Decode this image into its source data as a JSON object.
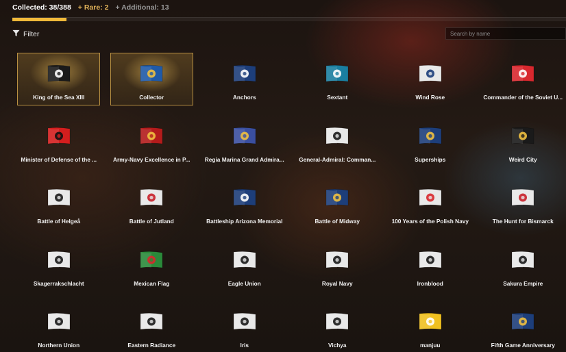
{
  "header": {
    "collected": "Collected: 38/388",
    "rare": "+ Rare: 2",
    "additional": "+ Additional: 13",
    "progress_fraction": 0.098
  },
  "filter": {
    "label": "Filter"
  },
  "search": {
    "placeholder": "Search by name"
  },
  "flags": [
    {
      "name": "King of the Sea XIII",
      "rare": true,
      "colors": [
        "#1a1a1a",
        "#ffffff"
      ],
      "icon": "skull-flag-icon"
    },
    {
      "name": "Collector",
      "rare": true,
      "colors": [
        "#1f5aa8",
        "#f0c040"
      ],
      "icon": "collector-flag-icon"
    },
    {
      "name": "Anchors",
      "rare": false,
      "colors": [
        "#1d3e7a",
        "#ffffff"
      ],
      "icon": "anchors-flag-icon"
    },
    {
      "name": "Sextant",
      "rare": false,
      "colors": [
        "#1a7ea0",
        "#ffffff"
      ],
      "icon": "sextant-flag-icon"
    },
    {
      "name": "Wind Rose",
      "rare": false,
      "colors": [
        "#e8e8e8",
        "#1d3e7a"
      ],
      "icon": "wind-rose-flag-icon"
    },
    {
      "name": "Commander of the Soviet U...",
      "rare": false,
      "colors": [
        "#d8282e",
        "#ffffff"
      ],
      "icon": "soviet-commander-flag-icon"
    },
    {
      "name": "Minister of Defense of the ...",
      "rare": false,
      "colors": [
        "#d41e1e",
        "#111111"
      ],
      "icon": "minister-defense-flag-icon"
    },
    {
      "name": "Army-Navy Excellence in P...",
      "rare": false,
      "colors": [
        "#b31b1b",
        "#f0c040"
      ],
      "icon": "army-navy-flag-icon"
    },
    {
      "name": "Regia Marina Grand Admira...",
      "rare": false,
      "colors": [
        "#3a4fa0",
        "#f0c040"
      ],
      "icon": "regia-marina-flag-icon"
    },
    {
      "name": "General-Admiral: Comman...",
      "rare": false,
      "colors": [
        "#e8e8e8",
        "#1a1a1a"
      ],
      "icon": "general-admiral-flag-icon"
    },
    {
      "name": "Superships",
      "rare": false,
      "colors": [
        "#1d3e7a",
        "#f0c040"
      ],
      "icon": "superships-flag-icon"
    },
    {
      "name": "Weird City",
      "rare": false,
      "colors": [
        "#1a1a1a",
        "#f0c040"
      ],
      "icon": "weird-city-flag-icon"
    },
    {
      "name": "Battle of Helgeå",
      "rare": false,
      "colors": [
        "#e8e8e8",
        "#1a1a1a"
      ],
      "icon": "helgea-flag-icon"
    },
    {
      "name": "Battle of Jutland",
      "rare": false,
      "colors": [
        "#e8e8e8",
        "#c8202a"
      ],
      "icon": "jutland-flag-icon"
    },
    {
      "name": "Battleship Arizona Memorial",
      "rare": false,
      "colors": [
        "#1d3e7a",
        "#ffffff"
      ],
      "icon": "arizona-flag-icon"
    },
    {
      "name": "Battle of Midway",
      "rare": false,
      "colors": [
        "#1d3e7a",
        "#f0c040"
      ],
      "icon": "midway-flag-icon"
    },
    {
      "name": "100 Years of the Polish Navy",
      "rare": false,
      "colors": [
        "#e8e8e8",
        "#d8282e"
      ],
      "icon": "polish-navy-flag-icon"
    },
    {
      "name": "The Hunt for Bismarck",
      "rare": false,
      "colors": [
        "#e8e8e8",
        "#c8202a"
      ],
      "icon": "bismarck-flag-icon"
    },
    {
      "name": "Skagerrakschlacht",
      "rare": false,
      "colors": [
        "#e8e8e8",
        "#1a1a1a"
      ],
      "icon": "skagerrak-flag-icon"
    },
    {
      "name": "Mexican Flag",
      "rare": false,
      "colors": [
        "#2a8a3a",
        "#d8282e"
      ],
      "icon": "mexican-flag-icon"
    },
    {
      "name": "Eagle Union",
      "rare": false,
      "colors": [
        "#e8e8e8",
        "#1a1a1a"
      ],
      "icon": "eagle-union-flag-icon"
    },
    {
      "name": "Royal Navy",
      "rare": false,
      "colors": [
        "#e8e8e8",
        "#1a1a1a"
      ],
      "icon": "royal-navy-flag-icon"
    },
    {
      "name": "Ironblood",
      "rare": false,
      "colors": [
        "#e8e8e8",
        "#1a1a1a"
      ],
      "icon": "ironblood-flag-icon"
    },
    {
      "name": "Sakura Empire",
      "rare": false,
      "colors": [
        "#e8e8e8",
        "#1a1a1a"
      ],
      "icon": "sakura-empire-flag-icon"
    },
    {
      "name": "Northern Union",
      "rare": false,
      "colors": [
        "#e8e8e8",
        "#1a1a1a"
      ],
      "icon": "northern-union-flag-icon"
    },
    {
      "name": "Eastern Radiance",
      "rare": false,
      "colors": [
        "#e8e8e8",
        "#1a1a1a"
      ],
      "icon": "eastern-radiance-flag-icon"
    },
    {
      "name": "Iris",
      "rare": false,
      "colors": [
        "#e8e8e8",
        "#1a1a1a"
      ],
      "icon": "iris-flag-icon"
    },
    {
      "name": "Vichya",
      "rare": false,
      "colors": [
        "#e8e8e8",
        "#1a1a1a"
      ],
      "icon": "vichya-flag-icon"
    },
    {
      "name": "manjuu",
      "rare": false,
      "colors": [
        "#f0c020",
        "#ffffff"
      ],
      "icon": "manjuu-flag-icon"
    },
    {
      "name": "Fifth Game Anniversary",
      "rare": false,
      "colors": [
        "#1d3e7a",
        "#f0c040"
      ],
      "icon": "anniversary-flag-icon"
    }
  ]
}
